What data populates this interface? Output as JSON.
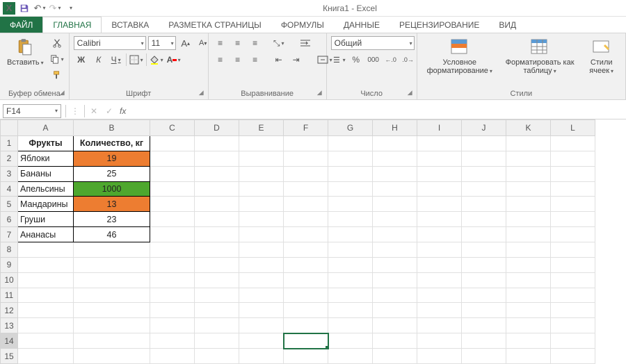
{
  "app": {
    "title": "Книга1 - Excel"
  },
  "qat": {
    "save": "save",
    "undo": "undo",
    "redo": "redo"
  },
  "tabs": {
    "file": "ФАЙЛ",
    "items": [
      "ГЛАВНАЯ",
      "ВСТАВКА",
      "РАЗМЕТКА СТРАНИЦЫ",
      "ФОРМУЛЫ",
      "ДАННЫЕ",
      "РЕЦЕНЗИРОВАНИЕ",
      "ВИД"
    ],
    "active_index": 0
  },
  "ribbon": {
    "clipboard": {
      "paste": "Вставить",
      "label": "Буфер обмена"
    },
    "font": {
      "name": "Calibri",
      "size": "11",
      "bold": "Ж",
      "italic": "К",
      "underline": "Ч",
      "label": "Шрифт"
    },
    "align": {
      "label": "Выравнивание"
    },
    "number": {
      "format": "Общий",
      "label": "Число"
    },
    "styles": {
      "cond": "Условное форматирование",
      "table": "Форматировать как таблицу",
      "cell": "Стили ячеек",
      "label": "Стили"
    }
  },
  "namebox": "F14",
  "columns": [
    "A",
    "B",
    "C",
    "D",
    "E",
    "F",
    "G",
    "H",
    "I",
    "J",
    "K",
    "L"
  ],
  "row_count": 15,
  "active": {
    "col": "F",
    "row": 14
  },
  "sheet": {
    "headers": [
      "Фрукты",
      "Количество, кг"
    ],
    "rows": [
      {
        "a": "Яблоки",
        "b": "19",
        "fill": "orange"
      },
      {
        "a": "Бананы",
        "b": "25",
        "fill": ""
      },
      {
        "a": "Апельсины",
        "b": "1000",
        "fill": "green"
      },
      {
        "a": "Мандарины",
        "b": "13",
        "fill": "orange"
      },
      {
        "a": "Груши",
        "b": "23",
        "fill": ""
      },
      {
        "a": "Ананасы",
        "b": "46",
        "fill": ""
      }
    ]
  },
  "colors": {
    "accent": "#217346",
    "orange": "#ed7d31",
    "green": "#4ea72e"
  }
}
